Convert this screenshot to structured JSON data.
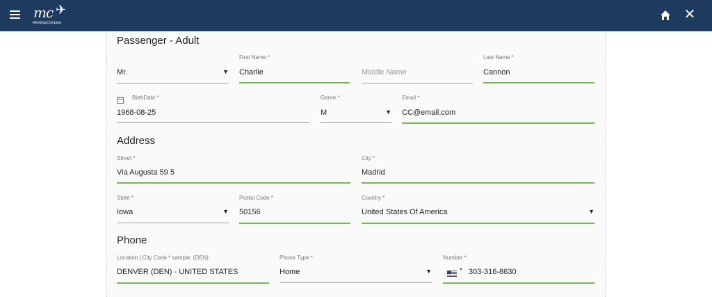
{
  "header": {
    "logo_text": "mc",
    "logo_tagline": "MeetingsCompass",
    "icons": [
      "menu-icon",
      "home-icon",
      "close-icon"
    ]
  },
  "passenger": {
    "title": "Passenger - Adult",
    "salutation": {
      "value": "Mr."
    },
    "first_name": {
      "label": "First Name *",
      "value": "Charlie"
    },
    "middle_name": {
      "placeholder": "Middle Name"
    },
    "last_name": {
      "label": "Last Name *",
      "value": "Cannon"
    },
    "birthdate": {
      "label": "BirthDate *",
      "value": "1968-08-25"
    },
    "genre": {
      "label": "Genre *",
      "value": "M"
    },
    "email": {
      "label": "Email *",
      "value": "CC@email.com"
    }
  },
  "address": {
    "title": "Address",
    "street": {
      "label": "Street *",
      "value": "Via Augusta 59 5"
    },
    "city": {
      "label": "City *",
      "value": "Madrid"
    },
    "state": {
      "label": "State *",
      "value": "Iowa"
    },
    "postal_code": {
      "label": "Postal Code *",
      "value": "50156"
    },
    "country": {
      "label": "Country *",
      "value": "United States Of America"
    }
  },
  "phone": {
    "title": "Phone",
    "location": {
      "label": "Location | City Code * sample: (DEN)",
      "value": "DENVER (DEN) - UNITED STATES"
    },
    "phone_type": {
      "label": "Phone Type *",
      "value": "Home"
    },
    "number": {
      "label": "Number *",
      "value": "303-316-8630"
    }
  },
  "colors": {
    "header_bg": "#1f3a5f",
    "valid_underline": "#6cc04a",
    "panel_bg": "#fafafa"
  }
}
